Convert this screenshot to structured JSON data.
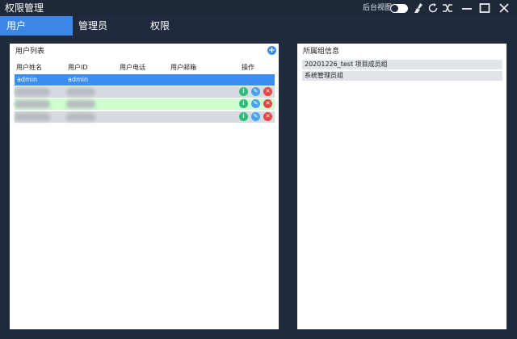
{
  "window": {
    "title": "权限管理",
    "background_view_label": "后台视图",
    "background_view_on": false,
    "icons": [
      "broom-icon",
      "refresh-icon",
      "shuffle-icon",
      "minimize-icon",
      "maximize-icon",
      "close-icon"
    ]
  },
  "tabs": [
    {
      "label": "用户",
      "active": true
    },
    {
      "label": "管理员",
      "active": false
    },
    {
      "label": "权限",
      "active": false
    }
  ],
  "user_panel": {
    "title": "用户列表",
    "add_icon": "plus-icon",
    "columns": [
      "用户姓名",
      "用户ID",
      "用户电话",
      "用户邮箱",
      "操作"
    ],
    "rows": [
      {
        "name": "admin",
        "id": "admin",
        "phone": "",
        "email": "",
        "state": "selected",
        "blurred": false
      },
      {
        "name": "",
        "id": "",
        "phone": "",
        "email": "",
        "state": "grey",
        "blurred": true
      },
      {
        "name": "",
        "id": "",
        "phone": "",
        "email": "",
        "state": "green",
        "blurred": true
      },
      {
        "name": "",
        "id": "",
        "phone": "",
        "email": "",
        "state": "grey",
        "blurred": true
      }
    ],
    "action_icons": [
      "info-icon",
      "edit-icon",
      "delete-icon"
    ],
    "action_glyphs": {
      "info": "i",
      "edit": "✎",
      "delete": "✕"
    }
  },
  "group_panel": {
    "title": "所属组信息",
    "items": [
      "20201226_test 项目成员组",
      "系统管理员组"
    ]
  },
  "colors": {
    "background": "#1f2a3c",
    "tab_active": "#3c86e6",
    "row_selected": "#3c8ef0",
    "row_highlight": "#ccffcc",
    "row_grey": "#d6dbe2"
  }
}
